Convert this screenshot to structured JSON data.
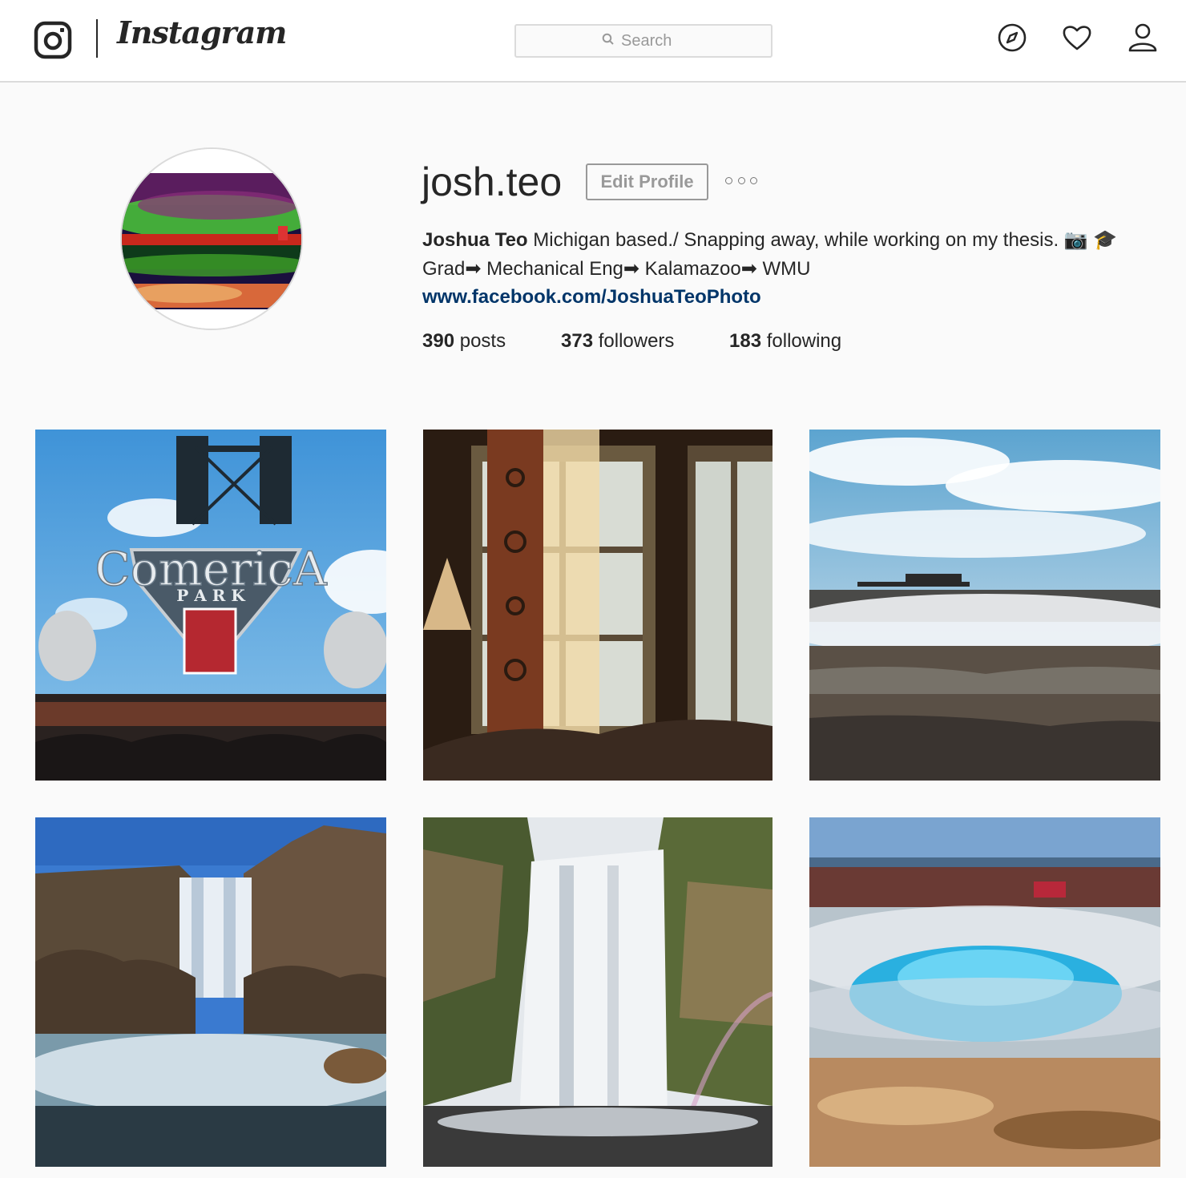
{
  "header": {
    "wordmark": "Instagram",
    "search_placeholder": "Search",
    "icons": [
      "camera-logo-icon",
      "compass-icon",
      "heart-icon",
      "person-icon"
    ]
  },
  "profile": {
    "username": "josh.teo",
    "edit_button": "Edit Profile",
    "full_name": "Joshua Teo",
    "bio_line1": " Michigan based./ Snapping away, while working on my thesis. 📷 🎓",
    "bio_line2": "Grad➡ Mechanical Eng➡ Kalamazoo➡ WMU",
    "website": "www.facebook.com/JoshuaTeoPhoto",
    "stats": {
      "posts_count": "390",
      "posts_label": " posts",
      "followers_count": "373",
      "followers_label": " followers",
      "following_count": "183",
      "following_label": " following"
    }
  },
  "posts": [
    {
      "subject": "stadium-sign",
      "sign_text": "ComericA",
      "sign_subtext": "P A R K"
    },
    {
      "subject": "window-curtain"
    },
    {
      "subject": "steam-field"
    },
    {
      "subject": "waterfall-rocks"
    },
    {
      "subject": "waterfall-canyon"
    },
    {
      "subject": "geyser-bubble"
    }
  ],
  "colors": {
    "link": "#003569",
    "border": "#dbdbdb",
    "background": "#fafafa",
    "text": "#262626"
  }
}
